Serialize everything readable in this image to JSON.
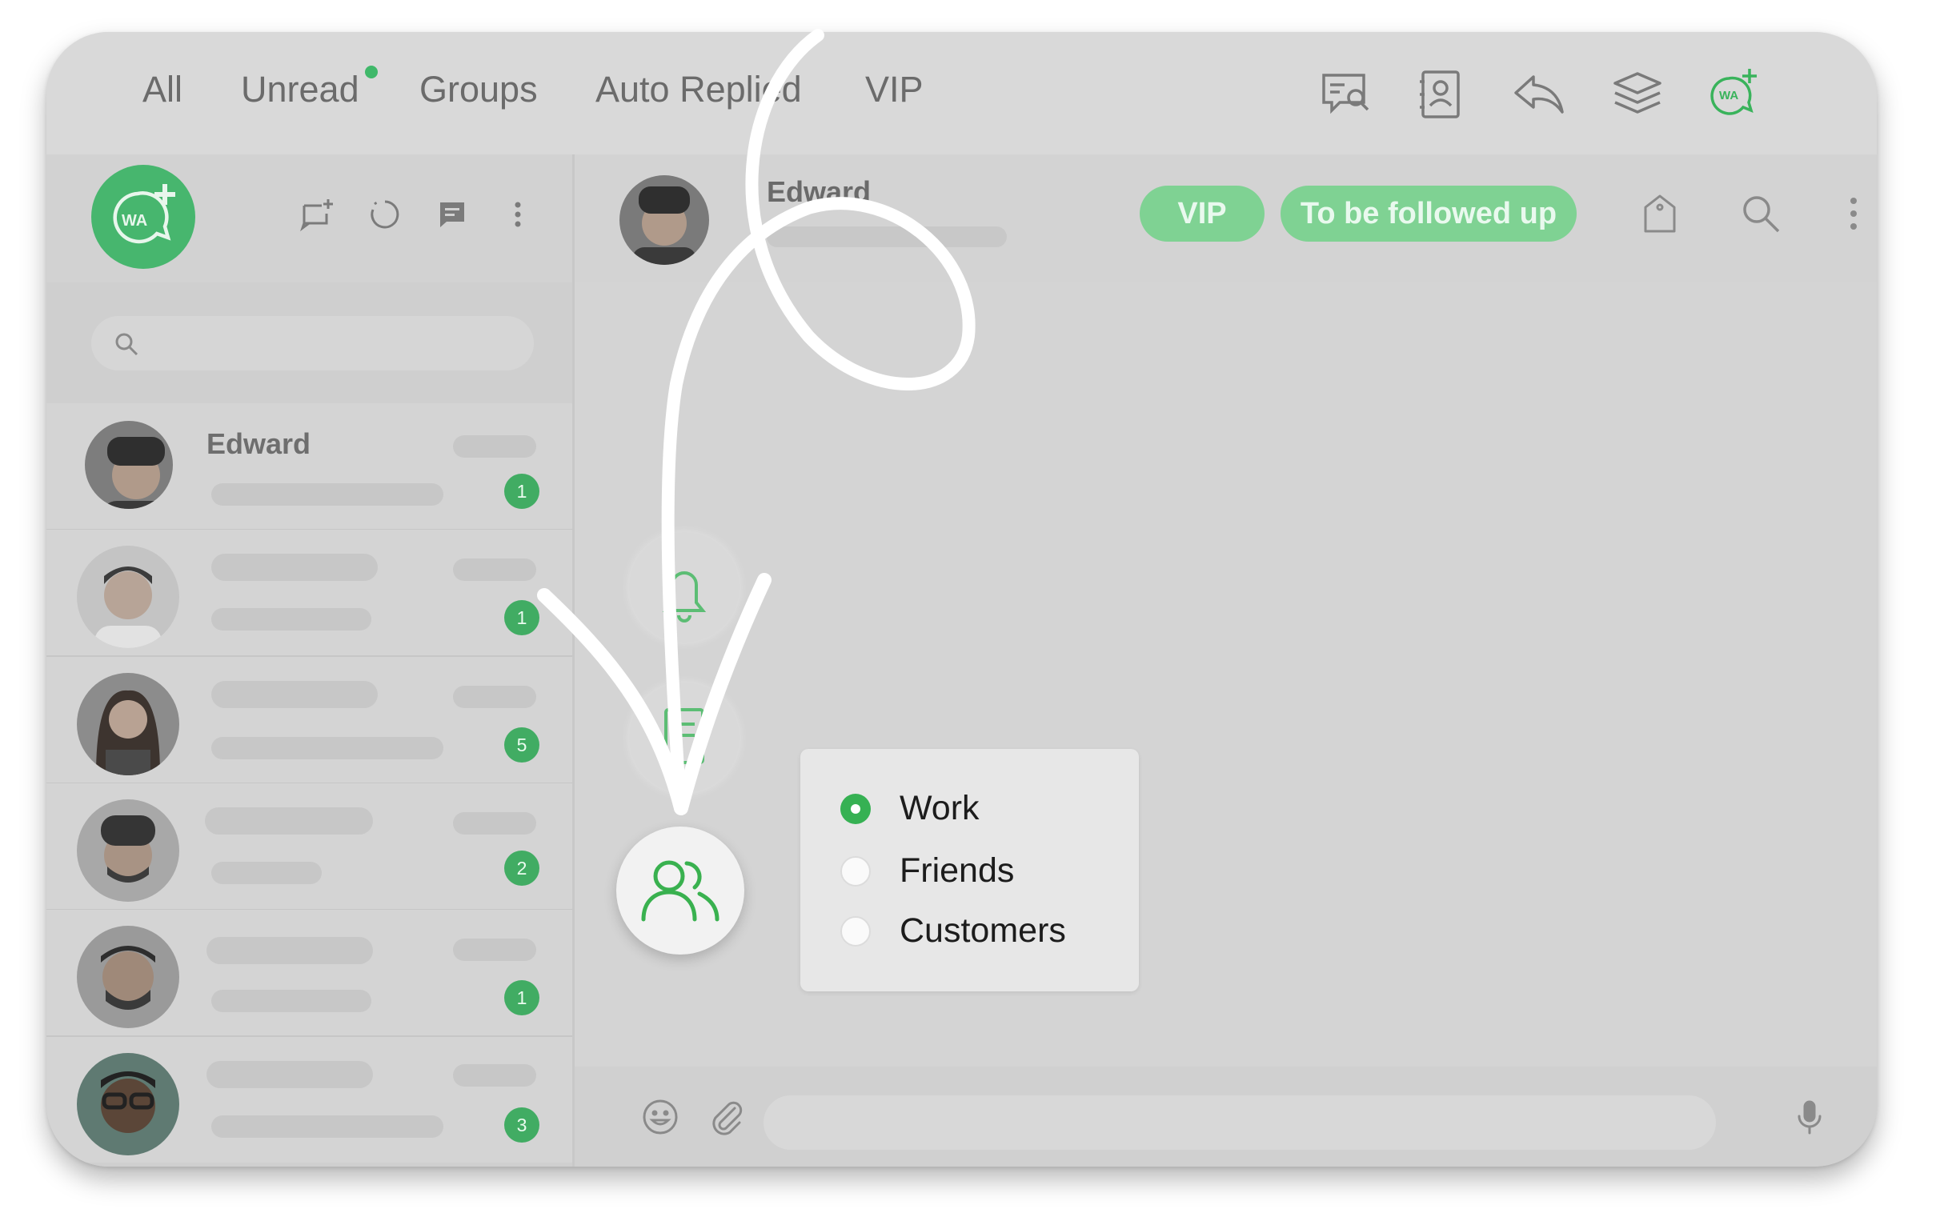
{
  "filter_tabs": [
    {
      "label": "All"
    },
    {
      "label": "Unread"
    },
    {
      "label": "Groups"
    },
    {
      "label": "Auto Replied"
    },
    {
      "label": "VIP"
    }
  ],
  "toolbar_icons": [
    "chat-search-icon",
    "contact-card-icon",
    "reply-icon",
    "layers-icon",
    "wa-add-icon"
  ],
  "sidebar": {
    "header_icons": [
      "new-chat-icon",
      "status-icon",
      "message-icon",
      "more-vertical-icon"
    ],
    "search_icon": "search-icon",
    "chats": [
      {
        "name": "Edward",
        "unread": "1"
      },
      {
        "name": "",
        "unread": "1"
      },
      {
        "name": "",
        "unread": "5"
      },
      {
        "name": "",
        "unread": "2"
      },
      {
        "name": "",
        "unread": "1"
      },
      {
        "name": "",
        "unread": "3"
      }
    ]
  },
  "chat_header": {
    "name": "Edward",
    "tags": [
      "VIP",
      "To be followed up"
    ],
    "icons": [
      "tag-icon",
      "search-icon",
      "more-vertical-icon"
    ]
  },
  "actions": [
    "bell-icon",
    "note-icon",
    "group-icon"
  ],
  "group_menu": {
    "options": [
      {
        "label": "Work",
        "selected": true
      },
      {
        "label": "Friends",
        "selected": false
      },
      {
        "label": "Customers",
        "selected": false
      }
    ]
  },
  "compose": {
    "icons": [
      "emoji-icon",
      "attach-icon",
      "mic-icon"
    ]
  },
  "colors": {
    "accent_green": "#36b153",
    "tag_green": "#7fd293",
    "badge_green": "#41ac63",
    "background_gray": "#d6d6d6"
  }
}
